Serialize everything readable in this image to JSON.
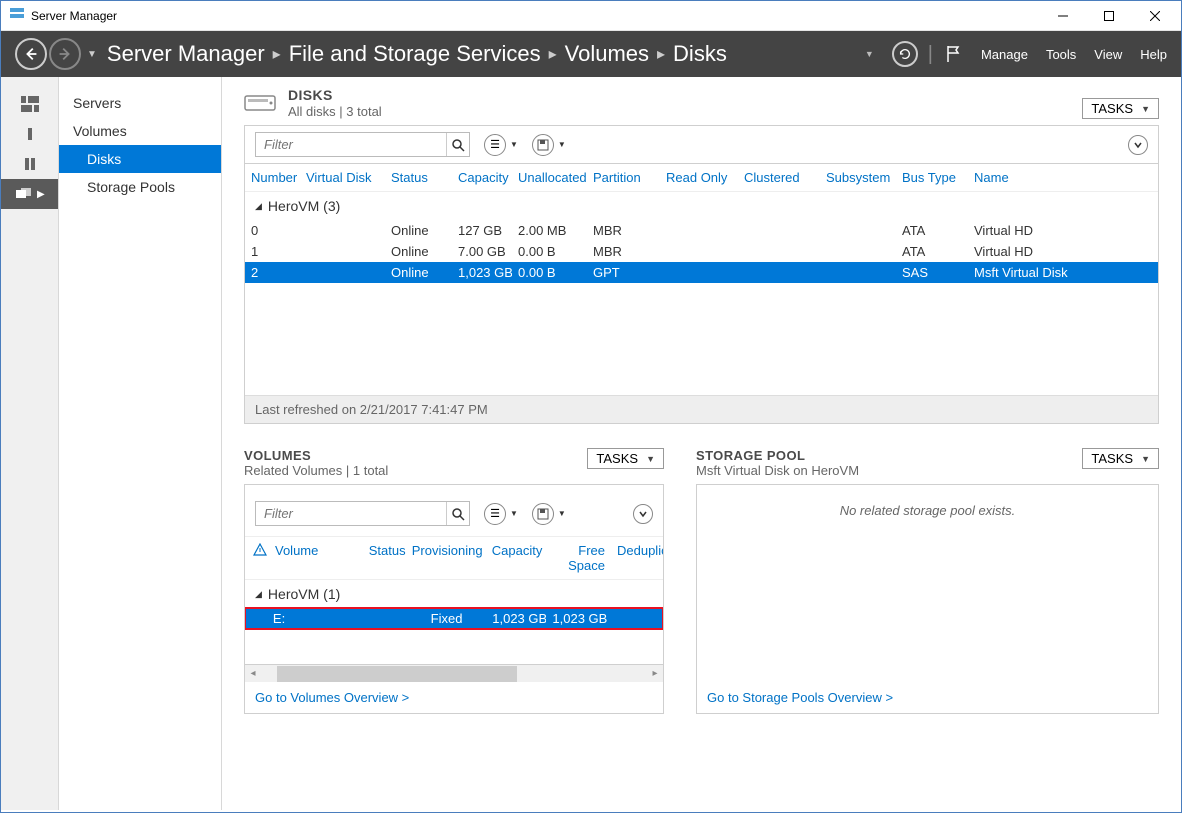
{
  "window": {
    "title": "Server Manager"
  },
  "breadcrumb": {
    "p0": "Server Manager",
    "p1": "File and Storage Services",
    "p2": "Volumes",
    "p3": "Disks"
  },
  "menus": {
    "manage": "Manage",
    "tools": "Tools",
    "view": "View",
    "help": "Help"
  },
  "sidebar": {
    "servers": "Servers",
    "volumes": "Volumes",
    "disks": "Disks",
    "storagePools": "Storage Pools"
  },
  "disksPanel": {
    "title": "DISKS",
    "subtitle": "All disks | 3 total",
    "tasks": "TASKS",
    "filterPlaceholder": "Filter",
    "cols": {
      "number": "Number",
      "vdisk": "Virtual Disk",
      "status": "Status",
      "capacity": "Capacity",
      "unalloc": "Unallocated",
      "partition": "Partition",
      "readonly": "Read Only",
      "clustered": "Clustered",
      "subsystem": "Subsystem",
      "bustype": "Bus Type",
      "name": "Name"
    },
    "group": "HeroVM (3)",
    "rows": [
      {
        "num": "0",
        "vdisk": "",
        "status": "Online",
        "cap": "127 GB",
        "unalloc": "2.00 MB",
        "part": "MBR",
        "ro": "",
        "cl": "",
        "sub": "",
        "bus": "ATA",
        "name": "Virtual HD"
      },
      {
        "num": "1",
        "vdisk": "",
        "status": "Online",
        "cap": "7.00 GB",
        "unalloc": "0.00 B",
        "part": "MBR",
        "ro": "",
        "cl": "",
        "sub": "",
        "bus": "ATA",
        "name": "Virtual HD"
      },
      {
        "num": "2",
        "vdisk": "",
        "status": "Online",
        "cap": "1,023 GB",
        "unalloc": "0.00 B",
        "part": "GPT",
        "ro": "",
        "cl": "",
        "sub": "",
        "bus": "SAS",
        "name": "Msft Virtual Disk"
      }
    ],
    "statusLine": "Last refreshed on 2/21/2017 7:41:47 PM"
  },
  "volumesPanel": {
    "title": "VOLUMES",
    "subtitle": "Related Volumes | 1 total",
    "tasks": "TASKS",
    "filterPlaceholder": "Filter",
    "cols": {
      "vol": "Volume",
      "status": "Status",
      "prov": "Provisioning",
      "cap": "Capacity",
      "free": "Free Space",
      "dedup": "Deduplic"
    },
    "group": "HeroVM (1)",
    "rows": [
      {
        "vol": "E:",
        "status": "",
        "prov": "Fixed",
        "cap": "1,023 GB",
        "free": "1,023 GB",
        "dedup": ""
      }
    ],
    "footer": "Go to Volumes Overview >"
  },
  "poolPanel": {
    "title": "STORAGE POOL",
    "subtitle": "Msft Virtual Disk on HeroVM",
    "tasks": "TASKS",
    "empty": "No related storage pool exists.",
    "footer": "Go to Storage Pools Overview >"
  }
}
